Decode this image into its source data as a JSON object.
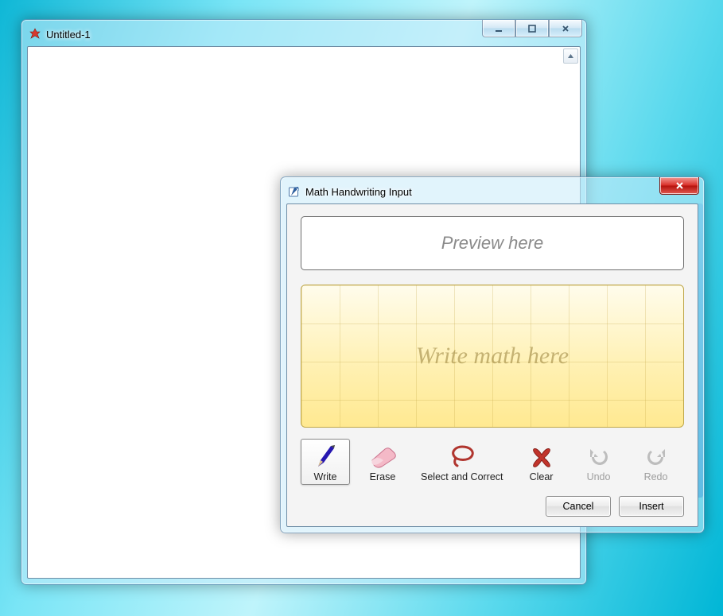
{
  "editor": {
    "title": "Untitled-1",
    "icon": "mathematica-icon"
  },
  "dialog": {
    "title": "Math Handwriting Input",
    "icon": "pencil-note-icon",
    "preview_placeholder": "Preview here",
    "canvas_placeholder": "Write math here",
    "tools": {
      "write": "Write",
      "erase": "Erase",
      "select": "Select and Correct",
      "clear": "Clear",
      "undo": "Undo",
      "redo": "Redo"
    },
    "buttons": {
      "cancel": "Cancel",
      "insert": "Insert"
    }
  }
}
